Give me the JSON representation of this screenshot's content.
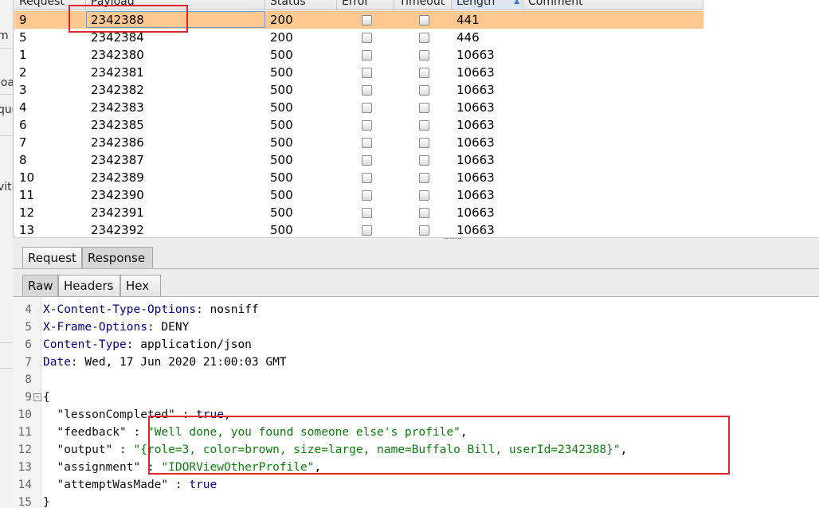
{
  "left_panel_fragments": [
    "m",
    "loa",
    "que",
    "vith"
  ],
  "table": {
    "columns": [
      "Request",
      "Payload",
      "Status",
      "Error",
      "Timeout",
      "Length",
      "Comment"
    ],
    "sorted_column": "Length",
    "rows": [
      {
        "request": "9",
        "payload": "2342388",
        "status": "200",
        "length": "441",
        "selected": true
      },
      {
        "request": "5",
        "payload": "2342384",
        "status": "200",
        "length": "446"
      },
      {
        "request": "1",
        "payload": "2342380",
        "status": "500",
        "length": "10663"
      },
      {
        "request": "2",
        "payload": "2342381",
        "status": "500",
        "length": "10663"
      },
      {
        "request": "3",
        "payload": "2342382",
        "status": "500",
        "length": "10663"
      },
      {
        "request": "4",
        "payload": "2342383",
        "status": "500",
        "length": "10663"
      },
      {
        "request": "6",
        "payload": "2342385",
        "status": "500",
        "length": "10663"
      },
      {
        "request": "7",
        "payload": "2342386",
        "status": "500",
        "length": "10663"
      },
      {
        "request": "8",
        "payload": "2342387",
        "status": "500",
        "length": "10663"
      },
      {
        "request": "10",
        "payload": "2342389",
        "status": "500",
        "length": "10663"
      },
      {
        "request": "11",
        "payload": "2342390",
        "status": "500",
        "length": "10663"
      },
      {
        "request": "12",
        "payload": "2342391",
        "status": "500",
        "length": "10663"
      },
      {
        "request": "13",
        "payload": "2342392",
        "status": "500",
        "length": "10663"
      }
    ]
  },
  "tabs_top": {
    "request": "Request",
    "response": "Response",
    "active": "Response"
  },
  "tabs_view": {
    "raw": "Raw",
    "headers": "Headers",
    "hex": "Hex",
    "active": "Raw"
  },
  "response": {
    "lines": [
      {
        "n": "4",
        "parts": [
          [
            "k",
            "X-Content-Type-Options"
          ],
          [
            "v",
            ": nosniff"
          ]
        ]
      },
      {
        "n": "5",
        "parts": [
          [
            "k",
            "X-Frame-Options"
          ],
          [
            "v",
            ": DENY"
          ]
        ]
      },
      {
        "n": "6",
        "parts": [
          [
            "k",
            "Content-Type"
          ],
          [
            "v",
            ": application/json"
          ]
        ]
      },
      {
        "n": "7",
        "parts": [
          [
            "k",
            "Date"
          ],
          [
            "v",
            ": Wed, 17 Jun 2020 21:00:03 GMT"
          ]
        ]
      },
      {
        "n": "8",
        "parts": []
      },
      {
        "n": "9",
        "fold": true,
        "parts": [
          [
            "v",
            "{"
          ]
        ]
      },
      {
        "n": "10",
        "parts": [
          [
            "q",
            "  \"lessonCompleted\""
          ],
          [
            "v",
            " : "
          ],
          [
            "k",
            "true"
          ],
          [
            "v",
            ","
          ]
        ]
      },
      {
        "n": "11",
        "parts": [
          [
            "q",
            "  \"feedback\""
          ],
          [
            "v",
            " : "
          ],
          [
            "s",
            "\"Well done, you found someone else's profile\""
          ],
          [
            "v",
            ","
          ]
        ]
      },
      {
        "n": "12",
        "parts": [
          [
            "q",
            "  \"output\""
          ],
          [
            "v",
            " : "
          ],
          [
            "s",
            "\"{role=3, color=brown, size=large, name=Buffalo Bill, userId=2342388}\""
          ],
          [
            "v",
            ","
          ]
        ]
      },
      {
        "n": "13",
        "parts": [
          [
            "q",
            "  \"assignment\""
          ],
          [
            "v",
            " : "
          ],
          [
            "s",
            "\"IDORViewOtherProfile\""
          ],
          [
            "v",
            ","
          ]
        ]
      },
      {
        "n": "14",
        "parts": [
          [
            "q",
            "  \"attemptWasMade\""
          ],
          [
            "v",
            " : "
          ],
          [
            "k",
            "true"
          ]
        ]
      },
      {
        "n": "15",
        "parts": [
          [
            "v",
            "}"
          ]
        ]
      }
    ]
  },
  "colors": {
    "selected_row": "#ffc891",
    "annotation": "#e0242b",
    "header_key": "#000080",
    "string": "#0f7a0f"
  }
}
